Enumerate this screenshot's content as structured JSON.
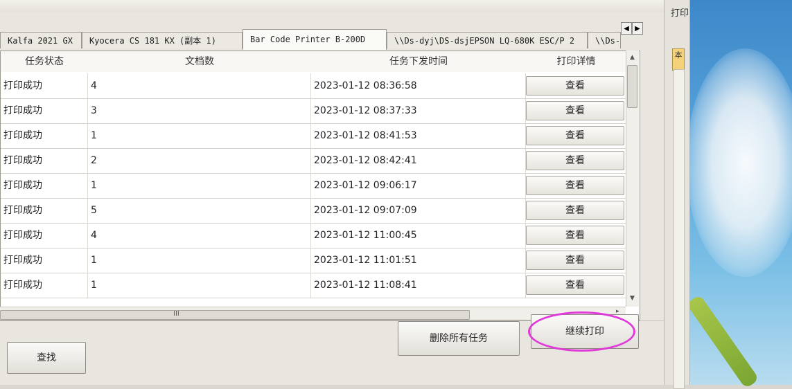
{
  "side": {
    "title": "打印",
    "tab_label": "本"
  },
  "tabs": [
    {
      "label": "Kalfa 2021 GX"
    },
    {
      "label": "Kyocera CS 181 KX (副本 1)"
    },
    {
      "label": "Bar Code Printer B-200D"
    },
    {
      "label": "\\\\Ds-dyj\\DS-dsjEPSON LQ-680K ESC/P 2"
    },
    {
      "label": "\\\\Ds-"
    }
  ],
  "tab_scroll": {
    "left": "◀",
    "right": "▶"
  },
  "table": {
    "headers": [
      "任务状态",
      "文档数",
      "任务下发时间",
      "打印详情"
    ],
    "rows": [
      {
        "status": "打印成功",
        "docs": "4",
        "time": "2023-01-12 08:36:58",
        "action": "查看"
      },
      {
        "status": "打印成功",
        "docs": "3",
        "time": "2023-01-12 08:37:33",
        "action": "查看"
      },
      {
        "status": "打印成功",
        "docs": "1",
        "time": "2023-01-12 08:41:53",
        "action": "查看"
      },
      {
        "status": "打印成功",
        "docs": "2",
        "time": "2023-01-12 08:42:41",
        "action": "查看"
      },
      {
        "status": "打印成功",
        "docs": "1",
        "time": "2023-01-12 09:06:17",
        "action": "查看"
      },
      {
        "status": "打印成功",
        "docs": "5",
        "time": "2023-01-12 09:07:09",
        "action": "查看"
      },
      {
        "status": "打印成功",
        "docs": "4",
        "time": "2023-01-12 11:00:45",
        "action": "查看"
      },
      {
        "status": "打印成功",
        "docs": "1",
        "time": "2023-01-12 11:01:51",
        "action": "查看"
      },
      {
        "status": "打印成功",
        "docs": "1",
        "time": "2023-01-12 11:08:41",
        "action": "查看"
      }
    ]
  },
  "scroll_marks": {
    "hthumb": "III",
    "up": "▲",
    "down": "▼",
    "right": "▸"
  },
  "buttons": {
    "search": "查找",
    "delete_all": "删除所有任务",
    "continue_print": "继续打印"
  },
  "colors": {
    "highlight": "#e03ad8"
  }
}
